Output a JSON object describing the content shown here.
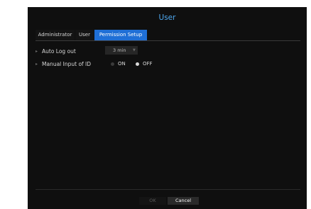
{
  "dialog": {
    "title": "User"
  },
  "tabs": [
    {
      "label": "Administrator",
      "active": false
    },
    {
      "label": "User",
      "active": false
    },
    {
      "label": "Permission Setup",
      "active": true
    }
  ],
  "settings": {
    "auto_logout": {
      "label": "Auto Log out",
      "value": "3 min",
      "dropdown_icon": "triangle-down-icon"
    },
    "manual_id": {
      "label": "Manual Input of ID",
      "options": [
        {
          "label": "ON",
          "selected": false
        },
        {
          "label": "OFF",
          "selected": true
        }
      ]
    }
  },
  "buttons": {
    "ok": "OK",
    "cancel": "Cancel"
  },
  "colors": {
    "accent": "#1f6fd6",
    "title": "#4ea8f0",
    "background": "#0f0f0f"
  }
}
